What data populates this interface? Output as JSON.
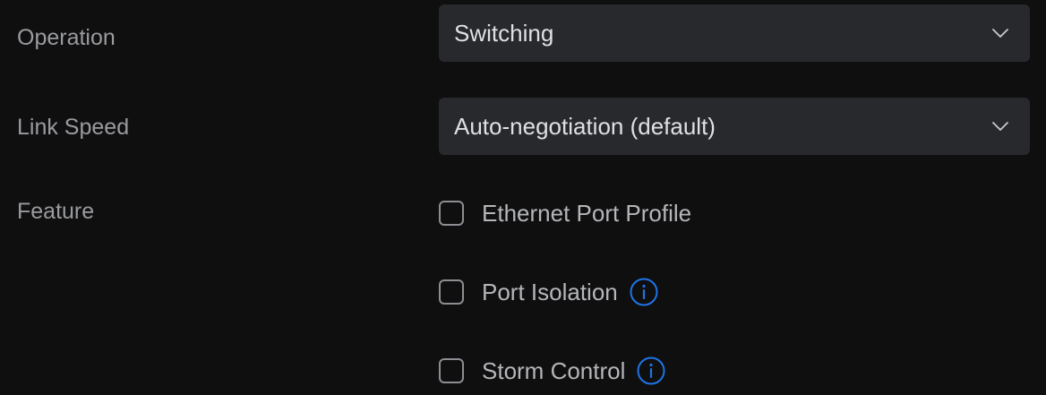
{
  "operation": {
    "label": "Operation",
    "value": "Switching",
    "icon": "chevron-down-icon"
  },
  "link_speed": {
    "label": "Link Speed",
    "value": "Auto-negotiation (default)",
    "icon": "chevron-down-icon"
  },
  "feature": {
    "label": "Feature",
    "options": [
      {
        "label": "Ethernet Port Profile",
        "checked": false,
        "has_info": false
      },
      {
        "label": "Port Isolation",
        "checked": false,
        "has_info": true,
        "info_icon": "info-icon"
      },
      {
        "label": "Storm Control",
        "checked": false,
        "has_info": true,
        "info_icon": "info-icon"
      }
    ]
  },
  "colors": {
    "background": "#0f0f10",
    "select_background": "#28292c",
    "info_accent": "#1f74e6"
  }
}
